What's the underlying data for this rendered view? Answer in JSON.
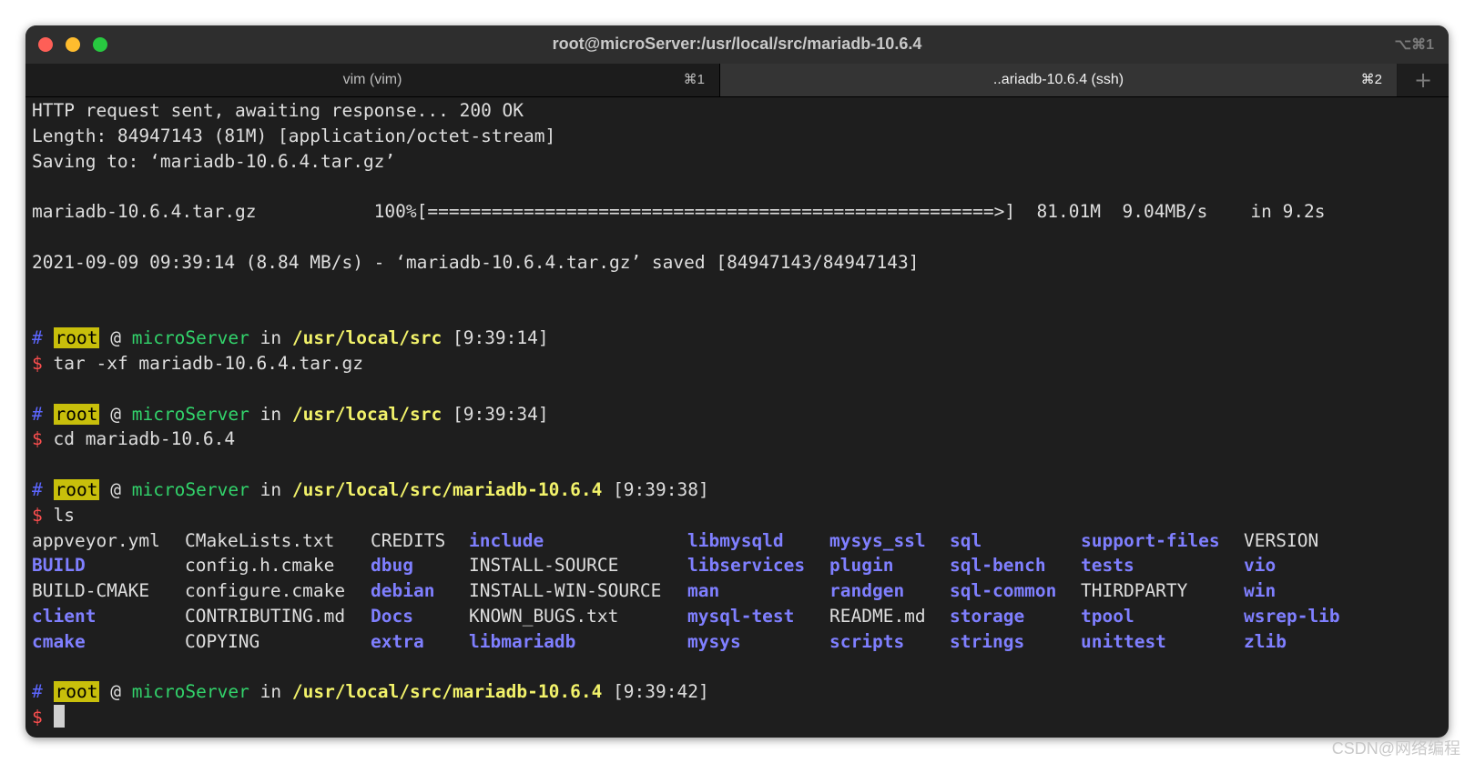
{
  "window": {
    "title": "root@microServer:/usr/local/src/mariadb-10.6.4",
    "title_shortcut": "⌥⌘1"
  },
  "tabs": [
    {
      "label": "vim (vim)",
      "shortcut": "⌘1"
    },
    {
      "label": "..ariadb-10.6.4 (ssh)",
      "shortcut": "⌘2"
    }
  ],
  "tab_add": "+",
  "terminal": {
    "lines": [
      "HTTP request sent, awaiting response... 200 OK",
      "Length: 84947143 (81M) [application/octet-stream]",
      "Saving to: ‘mariadb-10.6.4.tar.gz’",
      "",
      "mariadb-10.6.4.tar.gz           100%[=====================================================>]  81.01M  9.04MB/s    in 9.2s",
      "",
      "2021-09-09 09:39:14 (8.84 MB/s) - ‘mariadb-10.6.4.tar.gz’ saved [84947143/84947143]",
      "",
      ""
    ],
    "prompts": [
      {
        "hash": "#",
        "user": "root",
        "at": "@",
        "host": "microServer",
        "in": "in",
        "path": "/usr/local/src",
        "time": "[9:39:14]",
        "dollar": "$",
        "command": "tar -xf mariadb-10.6.4.tar.gz"
      },
      {
        "hash": "#",
        "user": "root",
        "at": "@",
        "host": "microServer",
        "in": "in",
        "path": "/usr/local/src",
        "time": "[9:39:34]",
        "dollar": "$",
        "command": "cd mariadb-10.6.4"
      },
      {
        "hash": "#",
        "user": "root",
        "at": "@",
        "host": "microServer",
        "in": "in",
        "path": "/usr/local/src/mariadb-10.6.4",
        "time": "[9:39:38]",
        "dollar": "$",
        "command": "ls"
      },
      {
        "hash": "#",
        "user": "root",
        "at": "@",
        "host": "microServer",
        "in": "in",
        "path": "/usr/local/src/mariadb-10.6.4",
        "time": "[9:39:42]",
        "dollar": "$",
        "command": ""
      }
    ],
    "ls_rows": [
      [
        {
          "name": "appveyor.yml",
          "type": "file"
        },
        {
          "name": "CMakeLists.txt",
          "type": "file"
        },
        {
          "name": "CREDITS",
          "type": "file"
        },
        {
          "name": "include",
          "type": "dir"
        },
        {
          "name": "libmysqld",
          "type": "dir"
        },
        {
          "name": "mysys_ssl",
          "type": "dir"
        },
        {
          "name": "sql",
          "type": "dir"
        },
        {
          "name": "support-files",
          "type": "dir"
        },
        {
          "name": "VERSION",
          "type": "file"
        }
      ],
      [
        {
          "name": "BUILD",
          "type": "dir"
        },
        {
          "name": "config.h.cmake",
          "type": "file"
        },
        {
          "name": "dbug",
          "type": "dir"
        },
        {
          "name": "INSTALL-SOURCE",
          "type": "file"
        },
        {
          "name": "libservices",
          "type": "dir"
        },
        {
          "name": "plugin",
          "type": "dir"
        },
        {
          "name": "sql-bench",
          "type": "dir"
        },
        {
          "name": "tests",
          "type": "dir"
        },
        {
          "name": "vio",
          "type": "dir"
        }
      ],
      [
        {
          "name": "BUILD-CMAKE",
          "type": "file"
        },
        {
          "name": "configure.cmake",
          "type": "file"
        },
        {
          "name": "debian",
          "type": "dir"
        },
        {
          "name": "INSTALL-WIN-SOURCE",
          "type": "file"
        },
        {
          "name": "man",
          "type": "dir"
        },
        {
          "name": "randgen",
          "type": "dir"
        },
        {
          "name": "sql-common",
          "type": "dir"
        },
        {
          "name": "THIRDPARTY",
          "type": "file"
        },
        {
          "name": "win",
          "type": "dir"
        }
      ],
      [
        {
          "name": "client",
          "type": "dir"
        },
        {
          "name": "CONTRIBUTING.md",
          "type": "file"
        },
        {
          "name": "Docs",
          "type": "dir"
        },
        {
          "name": "KNOWN_BUGS.txt",
          "type": "file"
        },
        {
          "name": "mysql-test",
          "type": "dir"
        },
        {
          "name": "README.md",
          "type": "file"
        },
        {
          "name": "storage",
          "type": "dir"
        },
        {
          "name": "tpool",
          "type": "dir"
        },
        {
          "name": "wsrep-lib",
          "type": "dir"
        }
      ],
      [
        {
          "name": "cmake",
          "type": "dir"
        },
        {
          "name": "COPYING",
          "type": "file"
        },
        {
          "name": "extra",
          "type": "dir"
        },
        {
          "name": "libmariadb",
          "type": "dir"
        },
        {
          "name": "mysys",
          "type": "dir"
        },
        {
          "name": "scripts",
          "type": "dir"
        },
        {
          "name": "strings",
          "type": "dir"
        },
        {
          "name": "unittest",
          "type": "dir"
        },
        {
          "name": "zlib",
          "type": "dir"
        }
      ]
    ]
  },
  "colors": {
    "background": "#1e1e1e",
    "prompt_hash": "#5c66ff",
    "prompt_user_bg": "#c8bf0b",
    "prompt_host": "#32d36b",
    "prompt_path": "#f2f26a",
    "prompt_dollar": "#ff4f4f",
    "directory": "#7f7fff"
  },
  "watermark": "CSDN@网络编程"
}
